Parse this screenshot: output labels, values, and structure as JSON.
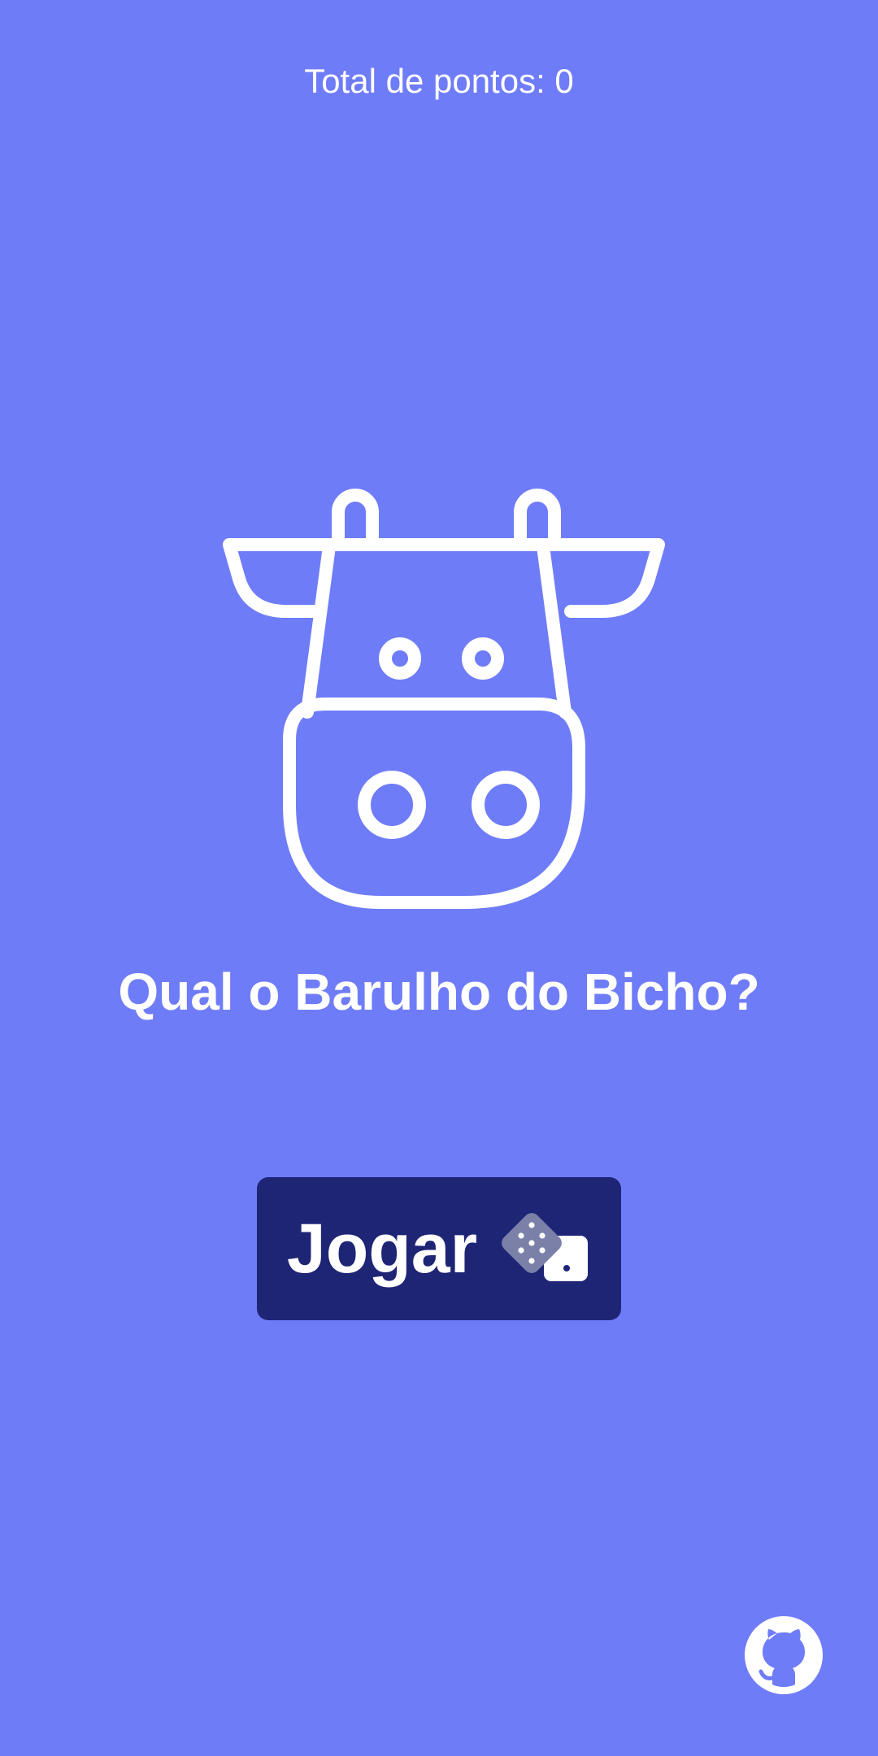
{
  "header": {
    "score_label": "Total de pontos: 0"
  },
  "hero": {
    "icon": "cow-icon",
    "title": "Qual o Barulho do Bicho?"
  },
  "actions": {
    "play_label": "Jogar",
    "play_icon": "dice-icon"
  },
  "footer": {
    "link_icon": "github-icon"
  },
  "colors": {
    "background": "#6f7cf7",
    "button": "#1f2575",
    "text": "#ffffff",
    "dice": "#7a80a8"
  }
}
